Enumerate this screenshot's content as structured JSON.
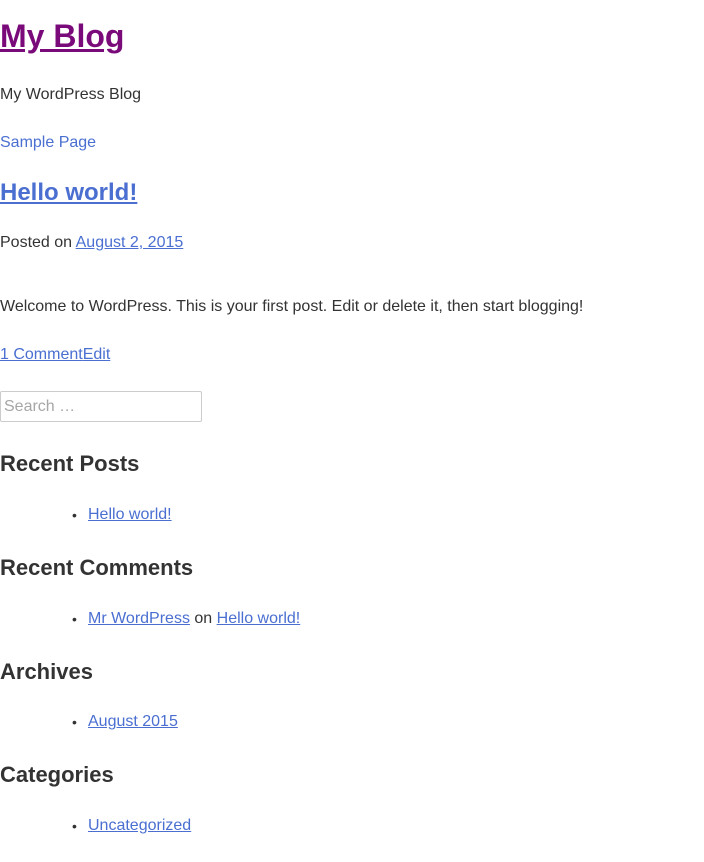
{
  "site": {
    "title": "My Blog",
    "description": "My WordPress Blog"
  },
  "nav": {
    "sample_page": "Sample Page"
  },
  "post": {
    "title": "Hello world!",
    "posted_on_label": "Posted on",
    "date": "August 2, 2015",
    "content": "Welcome to WordPress. This is your first post. Edit or delete it, then start blogging!",
    "comments_link": "1 Comment",
    "edit_link": "Edit"
  },
  "search": {
    "placeholder": "Search …"
  },
  "widgets": {
    "recent_posts": {
      "title": "Recent Posts",
      "items": [
        "Hello world!"
      ]
    },
    "recent_comments": {
      "title": "Recent Comments",
      "author": "Mr WordPress",
      "connector": "on",
      "post": "Hello world!"
    },
    "archives": {
      "title": "Archives",
      "items": [
        "August 2015"
      ]
    },
    "categories": {
      "title": "Categories",
      "items": [
        "Uncategorized"
      ]
    }
  },
  "colors": {
    "link": "#4a6fd1",
    "visited_title": "#7a0a7a",
    "text": "#333333"
  }
}
